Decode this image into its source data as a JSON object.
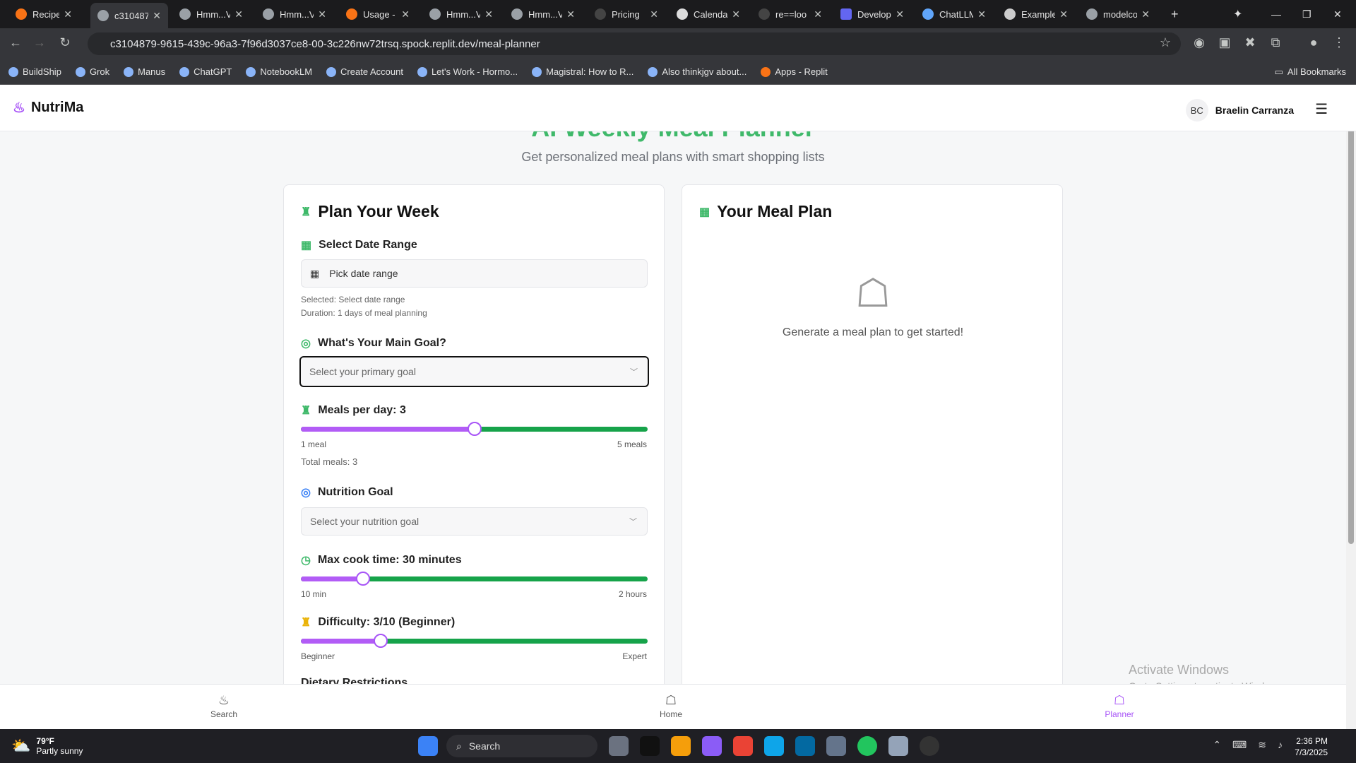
{
  "browser": {
    "tabs": [
      {
        "label": "RecipeA"
      },
      {
        "label": "c310487"
      },
      {
        "label": "Hmm...V"
      },
      {
        "label": "Hmm...V"
      },
      {
        "label": "Usage -"
      },
      {
        "label": "Hmm...V"
      },
      {
        "label": "Hmm...V"
      },
      {
        "label": "Pricing"
      },
      {
        "label": "Calenda"
      },
      {
        "label": "re==loo"
      },
      {
        "label": "Develop"
      },
      {
        "label": "ChatLLM"
      },
      {
        "label": "Example"
      },
      {
        "label": "modelco"
      }
    ],
    "url": "c3104879-9615-439c-96a3-7f96d3037ce8-00-3c226nw72trsq.spock.replit.dev/meal-planner",
    "bookmarks": [
      "BuildShip",
      "Grok",
      "Manus",
      "ChatGPT",
      "NotebookLM",
      "Create Account",
      "Let's Work - Hormo...",
      "Magistral: How to R...",
      "Also thinkjgv about...",
      "Apps - Replit"
    ],
    "all_bookmarks": "All Bookmarks"
  },
  "app": {
    "name": "NutriMa",
    "user_initials": "BC",
    "user_name": "Braelin Carranza",
    "hero_title": "AI Weekly Meal Planner",
    "hero_subtitle": "Get personalized meal plans with smart shopping lists"
  },
  "plan": {
    "title": "Plan Your Week",
    "date_label": "Select Date Range",
    "date_button": "Pick date range",
    "selected_text": "Selected: Select date range",
    "duration_text": "Duration: 1 days of meal planning",
    "goal_label": "What's Your Main Goal?",
    "goal_placeholder": "Select your primary goal",
    "meals_label": "Meals per day: 3",
    "meals_value": 3,
    "meals_min_label": "1 meal",
    "meals_max_label": "5 meals",
    "total_meals": "Total meals: 3",
    "nutrition_label": "Nutrition Goal",
    "nutrition_placeholder": "Select your nutrition goal",
    "cook_label": "Max cook time: 30 minutes",
    "cook_min_label": "10 min",
    "cook_max_label": "2 hours",
    "difficulty_label": "Difficulty: 3/10 (Beginner)",
    "difficulty_min_label": "Beginner",
    "difficulty_max_label": "Expert",
    "dietary_label": "Dietary Restrictions"
  },
  "sliders": {
    "meals_fraction": 0.5,
    "cook_fraction": 0.18,
    "difficulty_fraction": 0.23
  },
  "mealplan": {
    "title": "Your Meal Plan",
    "empty_text": "Generate a meal plan to get started!"
  },
  "bottom_nav": {
    "search": "Search",
    "home": "Home",
    "planner": "Planner"
  },
  "watermark": {
    "line1": "Activate Windows",
    "line2": "Go to Settings to activate Windows."
  },
  "taskbar": {
    "temp": "79°F",
    "weather": "Partly sunny",
    "search": "Search",
    "time": "2:36 PM",
    "date": "7/3/2025"
  },
  "colors": {
    "accent_green": "#3fb96a",
    "accent_purple": "#a855f7"
  }
}
